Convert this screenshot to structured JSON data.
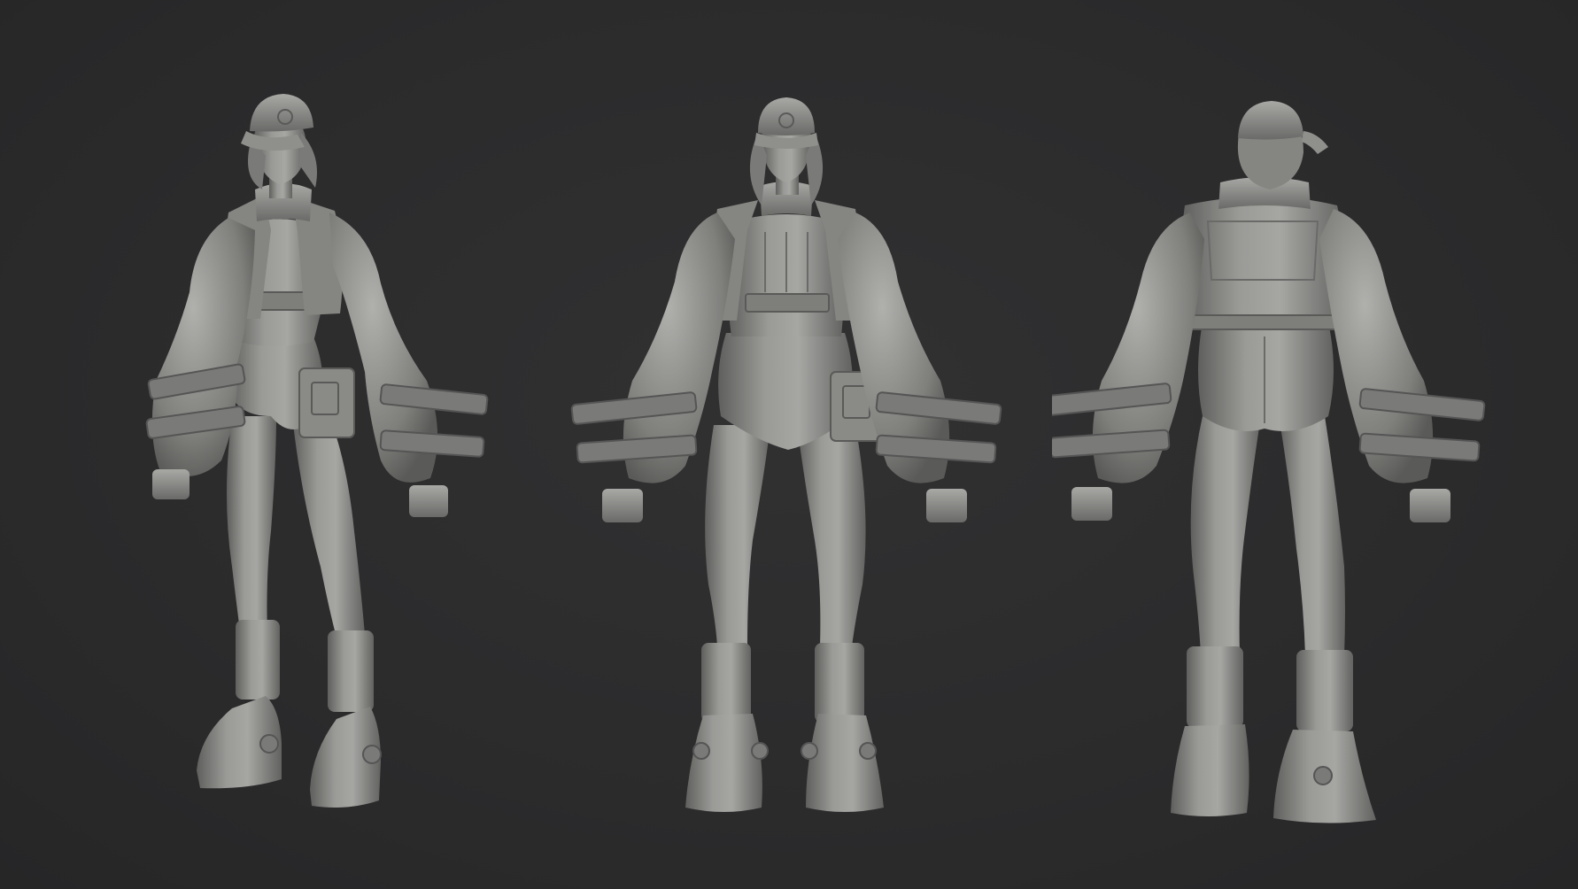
{
  "scene": {
    "background_color": "#2b2b2c",
    "model_color": "#8c8c8a",
    "model_shadow_color": "#5d5d5b",
    "model_highlight_color": "#b4b4b1",
    "views": [
      {
        "view": "three-quarter",
        "icon": "figure-three-quarter"
      },
      {
        "view": "front",
        "icon": "figure-front"
      },
      {
        "view": "back",
        "icon": "figure-back"
      }
    ]
  }
}
